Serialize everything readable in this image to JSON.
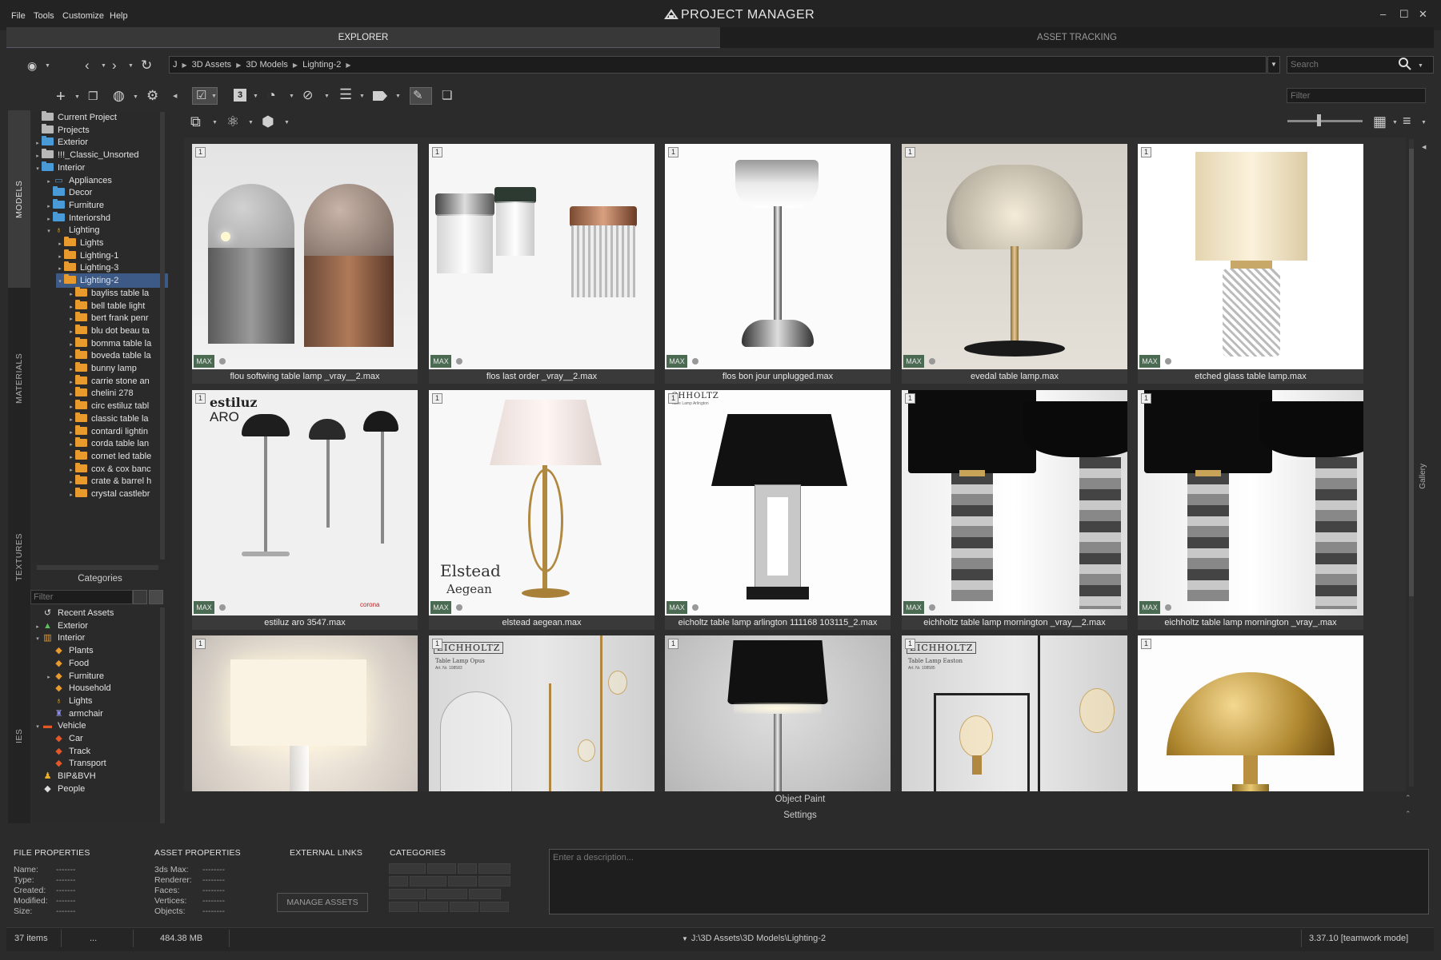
{
  "menu": [
    "File",
    "Tools",
    "Customize",
    "Help"
  ],
  "app_title": "PROJECT MANAGER",
  "tabs": [
    "EXPLORER",
    "ASSET TRACKING"
  ],
  "breadcrumb": [
    "J",
    "3D Assets",
    "3D Models",
    "Lighting-2"
  ],
  "search": {
    "placeholder": "Search"
  },
  "filter": {
    "placeholder": "Filter"
  },
  "vtabs": [
    "MODELS",
    "MATERIALS",
    "TEXTURES",
    "IES"
  ],
  "tree": [
    {
      "label": "Current Project",
      "indent": 0,
      "icon": "gray",
      "arrow": ""
    },
    {
      "label": "Projects",
      "indent": 0,
      "icon": "gray",
      "arrow": ""
    },
    {
      "label": "Exterior",
      "indent": 0,
      "icon": "blue",
      "arrow": "▸"
    },
    {
      "label": "!!!_Classic_Unsorted",
      "indent": 0,
      "icon": "gray",
      "arrow": "▸"
    },
    {
      "label": "Interior",
      "indent": 0,
      "icon": "blue",
      "arrow": "▾"
    },
    {
      "label": "Appliances",
      "indent": 1,
      "icon": "tv",
      "arrow": "▸"
    },
    {
      "label": "Decor",
      "indent": 1,
      "icon": "blue",
      "arrow": ""
    },
    {
      "label": "Furniture",
      "indent": 1,
      "icon": "blue",
      "arrow": "▸"
    },
    {
      "label": "Interiorshd",
      "indent": 1,
      "icon": "blue",
      "arrow": "▸"
    },
    {
      "label": "Lighting",
      "indent": 1,
      "icon": "bulb",
      "arrow": "▾"
    },
    {
      "label": "Lights",
      "indent": 2,
      "icon": "orange",
      "arrow": "▸"
    },
    {
      "label": "Lighting-1",
      "indent": 2,
      "icon": "orange",
      "arrow": "▸"
    },
    {
      "label": "Lighting-3",
      "indent": 2,
      "icon": "orange",
      "arrow": "▸"
    },
    {
      "label": "Lighting-2",
      "indent": 2,
      "icon": "orange",
      "arrow": "▾",
      "selected": true
    },
    {
      "label": "bayliss table la",
      "indent": 3,
      "icon": "orange",
      "arrow": "▸"
    },
    {
      "label": "bell table light",
      "indent": 3,
      "icon": "orange",
      "arrow": "▸"
    },
    {
      "label": "bert frank penr",
      "indent": 3,
      "icon": "orange",
      "arrow": "▸"
    },
    {
      "label": "blu dot beau ta",
      "indent": 3,
      "icon": "orange",
      "arrow": "▸"
    },
    {
      "label": "bomma table la",
      "indent": 3,
      "icon": "orange",
      "arrow": "▸"
    },
    {
      "label": "boveda table la",
      "indent": 3,
      "icon": "orange",
      "arrow": "▸"
    },
    {
      "label": "bunny lamp",
      "indent": 3,
      "icon": "orange",
      "arrow": "▸"
    },
    {
      "label": "carrie stone an",
      "indent": 3,
      "icon": "orange",
      "arrow": "▸"
    },
    {
      "label": "chelini 278",
      "indent": 3,
      "icon": "orange",
      "arrow": "▸"
    },
    {
      "label": "circ estiluz tabl",
      "indent": 3,
      "icon": "orange",
      "arrow": "▸"
    },
    {
      "label": "classic table la",
      "indent": 3,
      "icon": "orange",
      "arrow": "▸"
    },
    {
      "label": "contardi lightin",
      "indent": 3,
      "icon": "orange",
      "arrow": "▸"
    },
    {
      "label": "corda table lan",
      "indent": 3,
      "icon": "orange",
      "arrow": "▸"
    },
    {
      "label": "cornet led table",
      "indent": 3,
      "icon": "orange",
      "arrow": "▸"
    },
    {
      "label": "cox & cox banc",
      "indent": 3,
      "icon": "orange",
      "arrow": "▸"
    },
    {
      "label": "crate & barrel h",
      "indent": 3,
      "icon": "orange",
      "arrow": "▸"
    },
    {
      "label": "crystal castlebr",
      "indent": 3,
      "icon": "orange",
      "arrow": "▸"
    }
  ],
  "categories_label": "Categories",
  "categories": [
    {
      "label": "Recent Assets",
      "indent": 0,
      "icon": "recent",
      "arrow": ""
    },
    {
      "label": "Exterior",
      "indent": 0,
      "icon": "tree",
      "arrow": "▸"
    },
    {
      "label": "Interior",
      "indent": 0,
      "icon": "shelf",
      "arrow": "▾"
    },
    {
      "label": "Plants",
      "indent": 1,
      "icon": "orangetag",
      "arrow": ""
    },
    {
      "label": "Food",
      "indent": 1,
      "icon": "orangetag",
      "arrow": ""
    },
    {
      "label": "Furniture",
      "indent": 1,
      "icon": "orangetag",
      "arrow": "▸"
    },
    {
      "label": "Household",
      "indent": 1,
      "icon": "orangetag",
      "arrow": ""
    },
    {
      "label": "Lights",
      "indent": 1,
      "icon": "bulb",
      "arrow": ""
    },
    {
      "label": "armchair",
      "indent": 1,
      "icon": "chair",
      "arrow": ""
    },
    {
      "label": "Vehicle",
      "indent": 0,
      "icon": "car",
      "arrow": "▾"
    },
    {
      "label": "Car",
      "indent": 1,
      "icon": "redtag",
      "arrow": ""
    },
    {
      "label": "Track",
      "indent": 1,
      "icon": "redtag",
      "arrow": ""
    },
    {
      "label": "Transport",
      "indent": 1,
      "icon": "redtag",
      "arrow": ""
    },
    {
      "label": "BIP&BVH",
      "indent": 0,
      "icon": "person",
      "arrow": ""
    },
    {
      "label": "People",
      "indent": 0,
      "icon": "whitetag",
      "arrow": ""
    }
  ],
  "assets": [
    {
      "label": "flou softwing table lamp _vray__2.max",
      "num": "1",
      "badge": "MAX",
      "thumb": "flou"
    },
    {
      "label": "flos last order _vray__2.max",
      "num": "1",
      "badge": "MAX",
      "thumb": "flos"
    },
    {
      "label": "flos bon jour unplugged.max",
      "num": "1",
      "badge": "MAX",
      "thumb": "bonjour"
    },
    {
      "label": "evedal table lamp.max",
      "num": "1",
      "badge": "MAX",
      "thumb": "evedal"
    },
    {
      "label": "etched glass table lamp.max",
      "num": "1",
      "badge": "MAX",
      "thumb": "etched"
    },
    {
      "label": "estiluz aro 3547.max",
      "num": "1",
      "badge": "MAX",
      "thumb": "estiluz"
    },
    {
      "label": "elstead aegean.max",
      "num": "1",
      "badge": "MAX",
      "thumb": "elstead"
    },
    {
      "label": "eicholtz table lamp arlington 111168 103115_2.max",
      "num": "1",
      "badge": "MAX",
      "thumb": "arlington"
    },
    {
      "label": "eichholtz table lamp mornington _vray__2.max",
      "num": "1",
      "badge": "MAX",
      "thumb": "mornington"
    },
    {
      "label": "eichholtz table lamp mornington _vray_.max",
      "num": "1",
      "badge": "MAX",
      "thumb": "mornington"
    },
    {
      "label": "",
      "num": "1",
      "badge": "",
      "thumb": "wall"
    },
    {
      "label": "",
      "num": "1",
      "badge": "",
      "thumb": "opus"
    },
    {
      "label": "",
      "num": "1",
      "badge": "",
      "thumb": "blackshade"
    },
    {
      "label": "",
      "num": "1",
      "badge": "",
      "thumb": "easton"
    },
    {
      "label": "",
      "num": "1",
      "badge": "",
      "thumb": "dome"
    }
  ],
  "thumb_text": {
    "estiluz_brand": "estiluz",
    "estiluz_model": "ARO",
    "estiluz_corner": "corona",
    "elstead1": "Elstead",
    "elstead2": "Aegean",
    "arlington_brand": "CHHOLTZ",
    "arlington_sub": "Table Lamp Arlington",
    "opus_brand": "EICHHOLTZ",
    "opus_sub1": "Table Lamp Opus",
    "opus_sub2": "Art. Nr. 108583",
    "easton_brand": "EICHHOLTZ",
    "easton_sub1": "Table Lamp Easton",
    "easton_sub2": "Art. Nr. 108585"
  },
  "gallery_bars": [
    "Object Paint",
    "Settings"
  ],
  "gallery_side": "Gallery",
  "file_properties": {
    "title": "FILE PROPERTIES",
    "rows": [
      [
        "Name:",
        "-------"
      ],
      [
        "Type:",
        "-------"
      ],
      [
        "Created:",
        "-------"
      ],
      [
        "Modified:",
        "-------"
      ],
      [
        "Size:",
        "-------"
      ]
    ]
  },
  "asset_properties": {
    "title": "ASSET PROPERTIES",
    "rows": [
      [
        "3ds Max:",
        "--------"
      ],
      [
        "Renderer:",
        "--------"
      ],
      [
        "Faces:",
        "--------"
      ],
      [
        "Vertices:",
        "--------"
      ],
      [
        "Objects:",
        "--------"
      ]
    ]
  },
  "external_links": "EXTERNAL LINKS",
  "manage_assets": "MANAGE ASSETS",
  "categories_title": "CATEGORIES",
  "description": {
    "placeholder": "Enter a description..."
  },
  "status": {
    "items": "37 items",
    "dots": "...",
    "size": "484.38 MB",
    "path": "J:\\3D Assets\\3D Models\\Lighting-2",
    "version": "3.37.10 [teamwork mode]"
  },
  "colors": {
    "accent": "#3d5a86",
    "badge": "#4a6a52",
    "bg": "#2b2b2b"
  }
}
